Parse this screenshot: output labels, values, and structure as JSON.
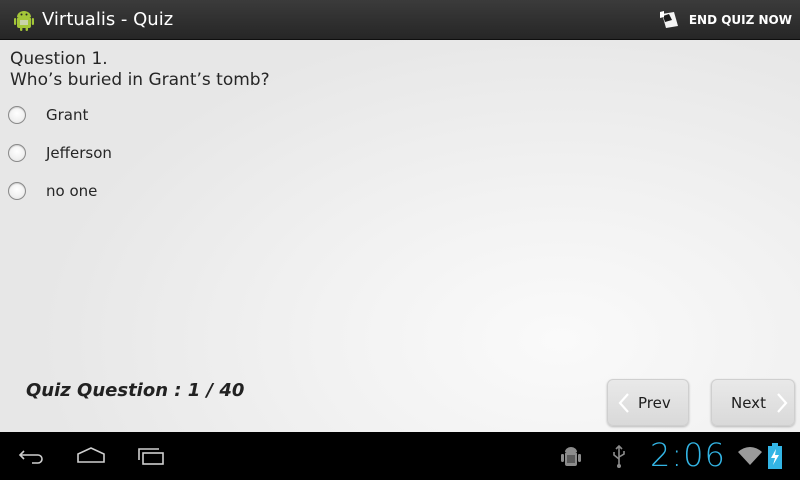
{
  "action_bar": {
    "title": "Virtualis - Quiz",
    "app_icon": "android-icon",
    "end_quiz_label": "END QUIZ NOW",
    "end_quiz_icon": "end-quiz-icon"
  },
  "question": {
    "number_label": "Question 1.",
    "text": "Who’s buried in Grant’s tomb?",
    "answers": [
      {
        "label": "Grant",
        "selected": false
      },
      {
        "label": "Jefferson",
        "selected": false
      },
      {
        "label": "no one",
        "selected": false
      }
    ]
  },
  "footer": {
    "counter": "Quiz Question : 1 / 40",
    "prev_label": "Prev",
    "next_label": "Next"
  },
  "system_bar": {
    "clock": "2:06",
    "clock_color": "#33b5e5",
    "icons": [
      "back-icon",
      "home-icon",
      "recents-icon",
      "debug-icon",
      "usb-icon",
      "wifi-icon",
      "battery-charging-icon"
    ]
  }
}
